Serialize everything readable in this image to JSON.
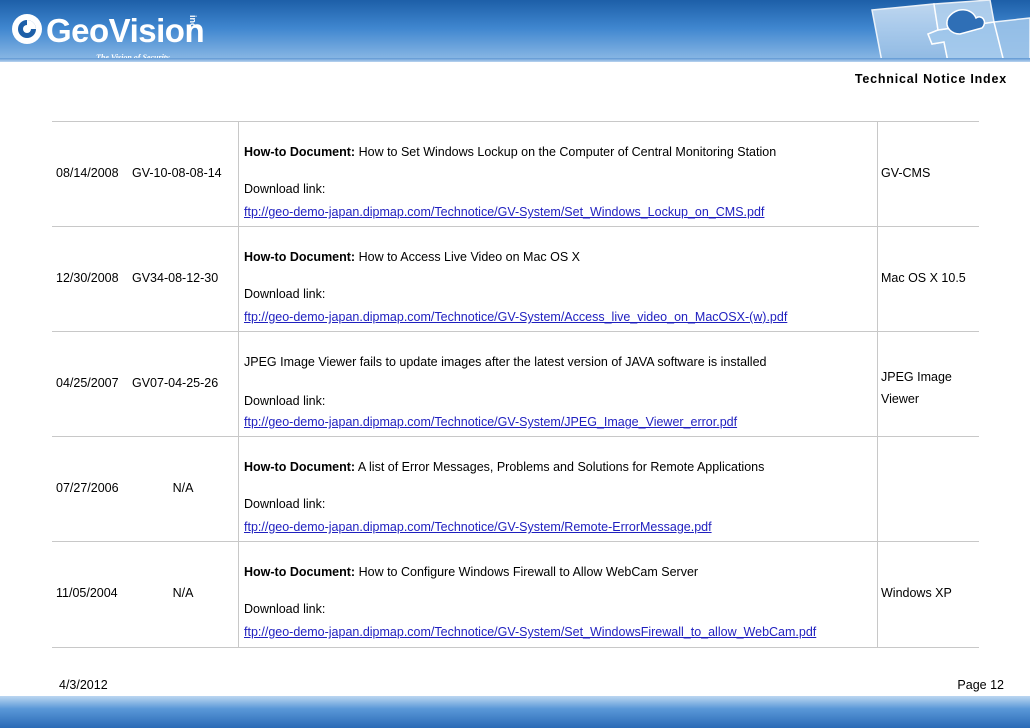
{
  "header": {
    "brand": "GeoVision",
    "brand_suffix": "inc",
    "tagline": "The Vision of Security",
    "title": "Technical Notice Index"
  },
  "rows": [
    {
      "date": "08/14/2008",
      "number": "GV-10-08-08-14",
      "doc_label": "How-to Document:",
      "doc_title": "How to Set Windows Lockup on the Computer of Central Monitoring Station",
      "download_label": "Download link:",
      "link": "ftp://geo-demo-japan.dipmap.com/Technotice/GV-System/Set_Windows_Lockup_on_CMS.pdf",
      "product": "GV-CMS"
    },
    {
      "date": "12/30/2008",
      "number": "GV34-08-12-30",
      "doc_label": "How-to Document:",
      "doc_title": "How to Access Live Video on Mac OS X",
      "download_label": "Download link:",
      "link": "ftp://geo-demo-japan.dipmap.com/Technotice/GV-System/Access_live_video_on_MacOSX-(w).pdf",
      "product": "Mac OS X 10.5"
    },
    {
      "date": "04/25/2007",
      "number": "GV07-04-25-26",
      "doc_label": "",
      "doc_title": "JPEG Image Viewer fails to update images after the latest version of JAVA software is installed",
      "download_label": "Download link:",
      "link": "ftp://geo-demo-japan.dipmap.com/Technotice/GV-System/JPEG_Image_Viewer_error.pdf",
      "product_line1": "JPEG Image",
      "product_line2": "Viewer"
    },
    {
      "date": "07/27/2006",
      "number": "N/A",
      "doc_label": "How-to Document:",
      "doc_title": "A list of Error Messages, Problems and Solutions for Remote Applications",
      "download_label": "Download link:",
      "link": "ftp://geo-demo-japan.dipmap.com/Technotice/GV-System/Remote-ErrorMessage.pdf",
      "product": ""
    },
    {
      "date": "11/05/2004",
      "number": "N/A",
      "doc_label": "How-to Document:",
      "doc_title": "How to Configure Windows Firewall to Allow WebCam Server",
      "download_label": "Download link:",
      "link": "ftp://geo-demo-japan.dipmap.com/Technotice/GV-System/Set_WindowsFirewall_to_allow_WebCam.pdf",
      "product": "Windows XP"
    }
  ],
  "footer": {
    "date": "4/3/2012",
    "page": "Page 12"
  },
  "colors": {
    "header_blue": "#1d5fa8",
    "link_blue": "#1f1fbf",
    "rule_gray": "#c8c8c8"
  }
}
